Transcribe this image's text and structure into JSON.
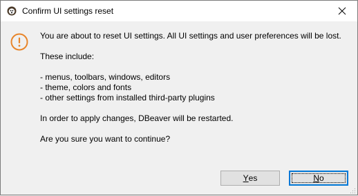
{
  "window": {
    "title": "Confirm UI settings reset",
    "close_glyph": "✕"
  },
  "message": {
    "intro": "You are about to reset UI settings. All UI settings and user preferences will be lost.",
    "includes_heading": "These include:",
    "items": [
      "- menus, toolbars, windows, editors",
      "- theme, colors and fonts",
      "- other settings from installed third-party plugins"
    ],
    "restart_notice": "In order to apply changes, DBeaver will be restarted.",
    "question": "Are you sure you want to continue?"
  },
  "buttons": {
    "yes_mnemonic": "Y",
    "yes_rest": "es",
    "no_mnemonic": "N",
    "no_rest": "o"
  },
  "colors": {
    "warning_accent": "#e8852a",
    "focus_border": "#0078d7"
  },
  "icons": {
    "app": "dbeaver-beaver-icon",
    "warning": "exclamation-circle-icon",
    "close": "close-icon"
  }
}
